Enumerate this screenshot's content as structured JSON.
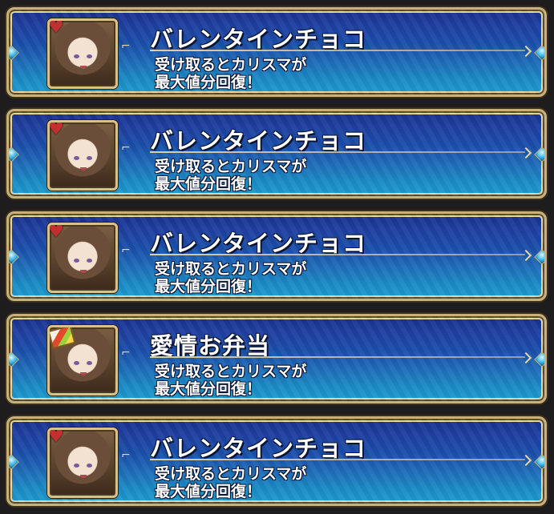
{
  "items": [
    {
      "title": "バレンタインチョコ",
      "line1": "受け取るとカリスマが",
      "line2": "最大値分回復！",
      "badge_icon": "heart-chocolate-icon"
    },
    {
      "title": "バレンタインチョコ",
      "line1": "受け取るとカリスマが",
      "line2": "最大値分回復！",
      "badge_icon": "heart-chocolate-icon"
    },
    {
      "title": "バレンタインチョコ",
      "line1": "受け取るとカリスマが",
      "line2": "最大値分回復！",
      "badge_icon": "heart-chocolate-icon"
    },
    {
      "title": "愛情お弁当",
      "line1": "受け取るとカリスマが",
      "line2": "最大値分回復！",
      "badge_icon": "bento-box-icon"
    },
    {
      "title": "バレンタインチョコ",
      "line1": "受け取るとカリスマが",
      "line2": "最大値分回復！",
      "badge_icon": "heart-chocolate-icon"
    }
  ],
  "colors": {
    "frame_gold": "#c9b27a",
    "panel_top": "#1a2f8a",
    "panel_bottom": "#1f9ccf",
    "text": "#ffffff"
  }
}
